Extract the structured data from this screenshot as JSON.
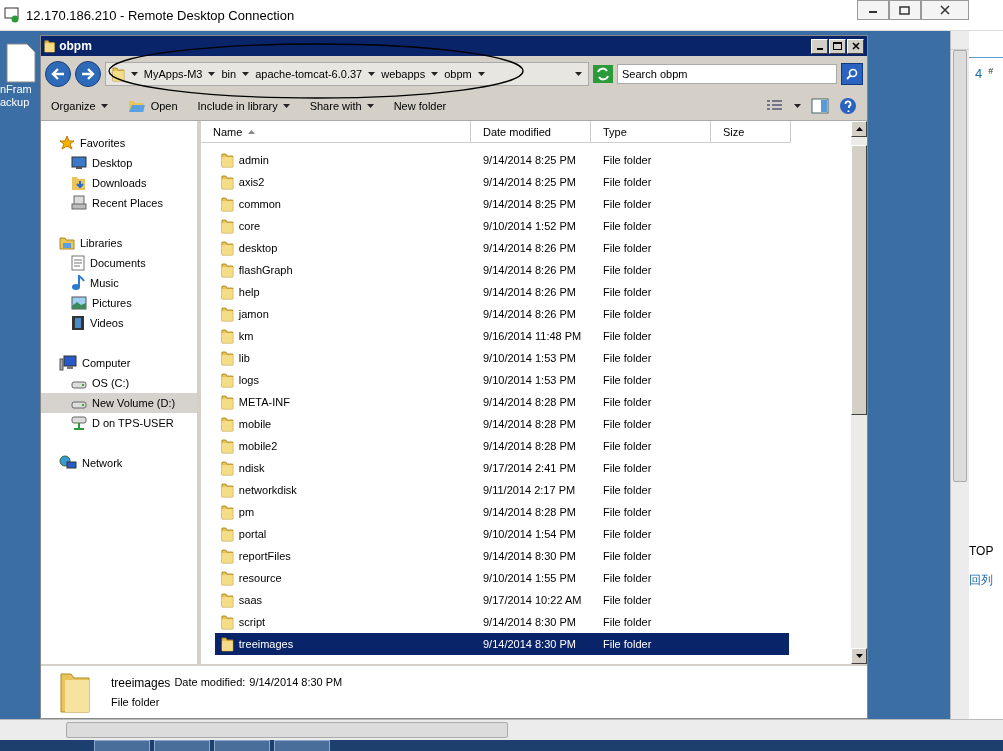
{
  "rdp_window": {
    "title": "12.170.186.210 - Remote Desktop Connection"
  },
  "desktop_icon": {
    "label_lines": [
      "nFram",
      "ackup"
    ]
  },
  "explorer": {
    "title": "obpm",
    "address": {
      "crumbs": [
        "MyApps-M3",
        "bin",
        "apache-tomcat-6.0.37",
        "webapps",
        "obpm"
      ],
      "search_placeholder": "Search obpm"
    },
    "commands": [
      {
        "label": "Organize",
        "kind": "menu"
      },
      {
        "label": "Open",
        "kind": "open"
      },
      {
        "label": "Include in library",
        "kind": "menu"
      },
      {
        "label": "Share with",
        "kind": "menu"
      },
      {
        "label": "New folder",
        "kind": "plain"
      }
    ],
    "nav": [
      {
        "label": "Favorites",
        "kind": "star",
        "selected": false,
        "children": [
          {
            "label": "Desktop",
            "kind": "desktop",
            "selected": false
          },
          {
            "label": "Downloads",
            "kind": "downloads",
            "selected": false
          },
          {
            "label": "Recent Places",
            "kind": "recent",
            "selected": false
          }
        ]
      },
      {
        "label": "Libraries",
        "kind": "library",
        "selected": false,
        "children": [
          {
            "label": "Documents",
            "kind": "document",
            "selected": false
          },
          {
            "label": "Music",
            "kind": "music",
            "selected": false
          },
          {
            "label": "Pictures",
            "kind": "pictures",
            "selected": false
          },
          {
            "label": "Videos",
            "kind": "videos",
            "selected": false
          }
        ]
      },
      {
        "label": "Computer",
        "kind": "computer",
        "selected": false,
        "children": [
          {
            "label": "OS (C:)",
            "kind": "drive",
            "selected": false
          },
          {
            "label": "New Volume (D:)",
            "kind": "drive",
            "selected": true
          },
          {
            "label": "D on TPS-USER",
            "kind": "netdrive",
            "selected": false
          }
        ]
      },
      {
        "label": "Network",
        "kind": "network",
        "selected": false
      }
    ],
    "columns": [
      "Name",
      "Date modified",
      "Type",
      "Size"
    ],
    "rows": [
      {
        "name": "admin",
        "date": "9/14/2014 8:25 PM",
        "type": "File folder",
        "selected": false
      },
      {
        "name": "axis2",
        "date": "9/14/2014 8:25 PM",
        "type": "File folder",
        "selected": false
      },
      {
        "name": "common",
        "date": "9/14/2014 8:25 PM",
        "type": "File folder",
        "selected": false
      },
      {
        "name": "core",
        "date": "9/10/2014 1:52 PM",
        "type": "File folder",
        "selected": false
      },
      {
        "name": "desktop",
        "date": "9/14/2014 8:26 PM",
        "type": "File folder",
        "selected": false
      },
      {
        "name": "flashGraph",
        "date": "9/14/2014 8:26 PM",
        "type": "File folder",
        "selected": false
      },
      {
        "name": "help",
        "date": "9/14/2014 8:26 PM",
        "type": "File folder",
        "selected": false
      },
      {
        "name": "jamon",
        "date": "9/14/2014 8:26 PM",
        "type": "File folder",
        "selected": false
      },
      {
        "name": "km",
        "date": "9/16/2014 11:48 PM",
        "type": "File folder",
        "selected": false
      },
      {
        "name": "lib",
        "date": "9/10/2014 1:53 PM",
        "type": "File folder",
        "selected": false
      },
      {
        "name": "logs",
        "date": "9/10/2014 1:53 PM",
        "type": "File folder",
        "selected": false
      },
      {
        "name": "META-INF",
        "date": "9/14/2014 8:28 PM",
        "type": "File folder",
        "selected": false
      },
      {
        "name": "mobile",
        "date": "9/14/2014 8:28 PM",
        "type": "File folder",
        "selected": false
      },
      {
        "name": "mobile2",
        "date": "9/14/2014 8:28 PM",
        "type": "File folder",
        "selected": false
      },
      {
        "name": "ndisk",
        "date": "9/17/2014 2:41 PM",
        "type": "File folder",
        "selected": false
      },
      {
        "name": "networkdisk",
        "date": "9/11/2014 2:17 PM",
        "type": "File folder",
        "selected": false
      },
      {
        "name": "pm",
        "date": "9/14/2014 8:28 PM",
        "type": "File folder",
        "selected": false
      },
      {
        "name": "portal",
        "date": "9/10/2014 1:54 PM",
        "type": "File folder",
        "selected": false
      },
      {
        "name": "reportFiles",
        "date": "9/14/2014 8:30 PM",
        "type": "File folder",
        "selected": false
      },
      {
        "name": "resource",
        "date": "9/10/2014 1:55 PM",
        "type": "File folder",
        "selected": false
      },
      {
        "name": "saas",
        "date": "9/17/2014 10:22 AM",
        "type": "File folder",
        "selected": false
      },
      {
        "name": "script",
        "date": "9/14/2014 8:30 PM",
        "type": "File folder",
        "selected": false
      },
      {
        "name": "treeimages",
        "date": "9/14/2014 8:30 PM",
        "type": "File folder",
        "selected": true
      }
    ],
    "details": {
      "name": "treeimages",
      "date_label": "Date modified:",
      "date": "9/14/2014 8:30 PM",
      "type": "File folder"
    }
  },
  "background_page": {
    "texts": [
      "4",
      "#",
      "TOP",
      "回列"
    ]
  }
}
